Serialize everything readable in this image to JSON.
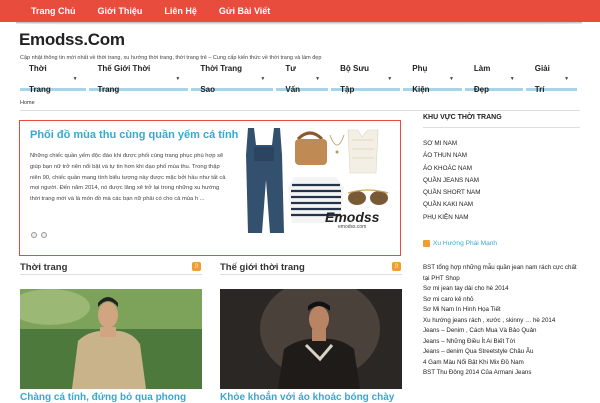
{
  "topnav": {
    "items": [
      "Trang Chủ",
      "Giới Thiệu",
      "Liên Hệ",
      "Gửi Bài Viết"
    ]
  },
  "site": {
    "title": "Emodss.Com",
    "tagline": "Cập nhật thông tin mới nhất về thời trang, xu hướng thời trang, thời trang trẻ – Cung cấp kiến thức về thời trang và làm đẹp"
  },
  "mainnav": {
    "items": [
      "Thời Trang",
      "Thế Giới Thời Trang",
      "Thời Trang Sao",
      "Tư Vấn",
      "Bộ Sưu Tập",
      "Phụ Kiện",
      "Làm Đẹp",
      "Giải Trí"
    ]
  },
  "breadcrumb": "Home",
  "slider": {
    "title": "Phối đồ mùa thu cùng quần yếm cá tính",
    "excerpt": "Những chiếc quần yếm độc đáo khi được phối cùng trang phục phù hợp sẽ giúp bạn nữ trở nên nổi bật và tự tin hơn khi dạo phố mùa thu. Trong thập niên 90, chiếc quần mang tính biểu tượng này được mặc bởi hầu như tất cả mọi người. Đến năm 2014, nó được lăng xê trở lại trong những xu hướng thời trang mới và là món đồ mà các bạn nữ phải có cho cả mùa h ...",
    "watermark": "Emodss",
    "watermark_sub": "emodss.com"
  },
  "col1": {
    "heading": "Thời trang",
    "post_title": "Chàng cá tính, đứng bỏ qua phong"
  },
  "col2": {
    "heading": "Thế giới thời trang",
    "post_title": "Khỏe khoắn với áo khoác bóng chày"
  },
  "sidebar": {
    "categories_title": "KHU VỰC THỜI TRANG",
    "categories": [
      "SƠ MI NAM",
      "ÁO THUN NAM",
      "ÁO KHOÁC NAM",
      "QUẦN JEANS NAM",
      "QUẦN SHORT NAM",
      "QUẦN KAKI NAM",
      "PHỤ KIỆN NAM"
    ],
    "feed_title": "Xu Hướng Phái Mạnh",
    "feed": [
      "BST tổng hợp những mẫu quần jean nam rách cực chất tại PHT Shop",
      "Sơ mi jean tay dài cho hè 2014",
      "Sơ mi caro kẻ nhỏ",
      "Sơ Mi Nam In Hình Họa Tiết",
      "Xu hướng jeans rách , xước , skinny … hè 2014",
      "Jeans – Denim , Cách Mua Và Bảo Quản",
      "Jeans – Những Điều Ít Ai Biết Tới",
      "Jeans – denim Qua Streetstyle Châu Âu",
      "4 Gam Màu Nổi Bật Khi Mix Đồ Nam",
      "BST Thu Đông 2014 Của Armani Jeans"
    ]
  },
  "colors": {
    "accent": "#e74c3c",
    "link": "#3aa7cf",
    "nav_underline": "#a7d5e8",
    "rss": "#f39c33"
  }
}
